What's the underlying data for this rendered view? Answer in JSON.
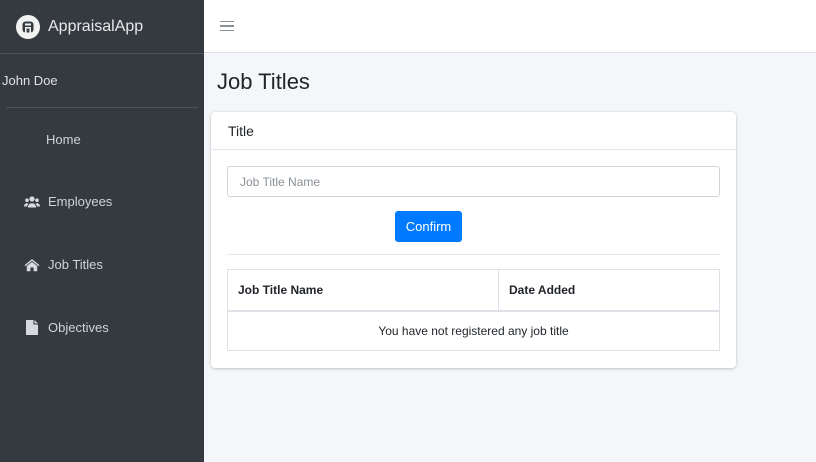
{
  "brand": {
    "name": "AppraisalApp",
    "logo_icon": "appraisal-logo-icon"
  },
  "user": {
    "name": "John Doe"
  },
  "sidebar": {
    "items": [
      {
        "label": "Home",
        "icon": ""
      },
      {
        "label": "Employees",
        "icon": "users-icon"
      },
      {
        "label": "Job Titles",
        "icon": "home-icon"
      },
      {
        "label": "Objectives",
        "icon": "file-icon"
      }
    ]
  },
  "topbar": {
    "menu_icon": "hamburger-icon"
  },
  "page": {
    "title": "Job Titles"
  },
  "card": {
    "header": "Title",
    "input_placeholder": "Job Title Name",
    "input_value": "",
    "confirm_label": "Confirm"
  },
  "table": {
    "columns": [
      "Job Title Name",
      "Date Added"
    ],
    "empty_message": "You have not registered any job title"
  },
  "colors": {
    "sidebar_bg": "#343a40",
    "content_bg": "#f4f6f9",
    "primary": "#007bff"
  }
}
